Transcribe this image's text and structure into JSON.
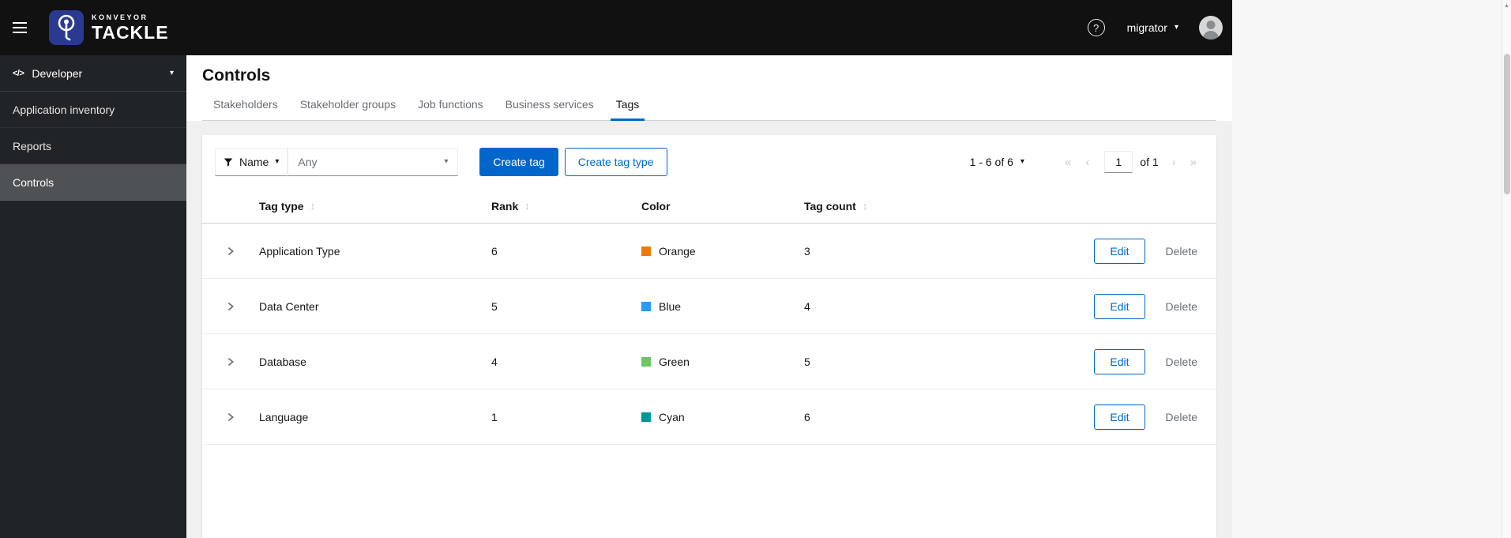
{
  "icons": {
    "caret_down": "▾",
    "sort": "↕",
    "first_page": "«",
    "previous_page": "‹",
    "next_page": "›",
    "last_page": "»",
    "help": "?",
    "scroll_up": "▲",
    "code": "</>"
  },
  "masthead": {
    "brand_top": "KONVEYOR",
    "brand_bottom": "TACKLE",
    "username": "migrator"
  },
  "sidebar": {
    "perspective_label": "Developer",
    "items": [
      {
        "label": "Application inventory",
        "active": false
      },
      {
        "label": "Reports",
        "active": false
      },
      {
        "label": "Controls",
        "active": true
      }
    ]
  },
  "page": {
    "title": "Controls",
    "tabs": [
      {
        "label": "Stakeholders",
        "active": false
      },
      {
        "label": "Stakeholder groups",
        "active": false
      },
      {
        "label": "Job functions",
        "active": false
      },
      {
        "label": "Business services",
        "active": false
      },
      {
        "label": "Tags",
        "active": true
      }
    ]
  },
  "toolbar": {
    "filter_category": "Name",
    "filter_value_placeholder": "Any",
    "create_tag_label": "Create tag",
    "create_tag_type_label": "Create tag type",
    "pagination": {
      "range_label": "1 - 6 of 6",
      "page": "1",
      "of_pages_label": "of 1"
    }
  },
  "table": {
    "columns": [
      {
        "label": "Tag type",
        "sortable": true
      },
      {
        "label": "Rank",
        "sortable": true
      },
      {
        "label": "Color",
        "sortable": false
      },
      {
        "label": "Tag count",
        "sortable": true
      }
    ],
    "action_labels": {
      "edit": "Edit",
      "delete": "Delete"
    },
    "rows": [
      {
        "tag_type": "Application Type",
        "rank": "6",
        "color_name": "Orange",
        "color_hex": "#ec7a08",
        "tag_count": "3"
      },
      {
        "tag_type": "Data Center",
        "rank": "5",
        "color_name": "Blue",
        "color_hex": "#2b9af3",
        "tag_count": "4"
      },
      {
        "tag_type": "Database",
        "rank": "4",
        "color_name": "Green",
        "color_hex": "#6ec664",
        "tag_count": "5"
      },
      {
        "tag_type": "Language",
        "rank": "1",
        "color_name": "Cyan",
        "color_hex": "#009596",
        "tag_count": "6"
      }
    ]
  },
  "colors": {
    "accent": "#0066cc",
    "masthead_bg": "#111111",
    "sidebar_bg": "#212427",
    "sidebar_active_bg": "#4f5255"
  }
}
